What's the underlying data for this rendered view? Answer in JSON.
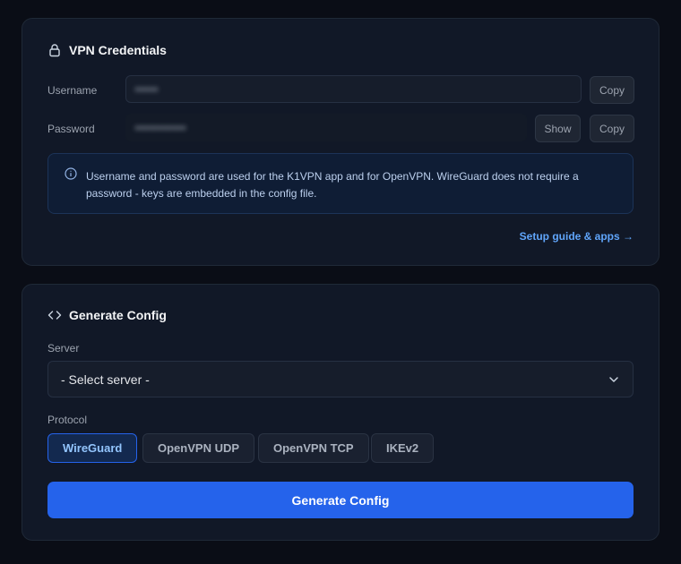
{
  "credentials": {
    "title": "VPN Credentials",
    "icon": "lock-icon",
    "username_label": "Username",
    "username_value": "•••••",
    "password_label": "Password",
    "password_value": "•••••••••••",
    "show_label": "Show",
    "copy_label": "Copy",
    "info_text": "Username and password are used for the K1VPN app and for OpenVPN. WireGuard does not require a password - keys are embedded in the config file.",
    "setup_link": "Setup guide & apps →"
  },
  "config": {
    "title": "Generate Config",
    "icon": "code-icon",
    "server_label": "Server",
    "server_selected": "- Select server -",
    "protocol_label": "Protocol",
    "protocols": [
      "WireGuard",
      "OpenVPN UDP",
      "OpenVPN TCP",
      "IKEv2"
    ],
    "active_protocol": "WireGuard",
    "generate_label": "Generate Config"
  },
  "colors": {
    "accent": "#2563eb",
    "link": "#60a5fa",
    "background": "#0a0d16",
    "card": "#111827"
  }
}
